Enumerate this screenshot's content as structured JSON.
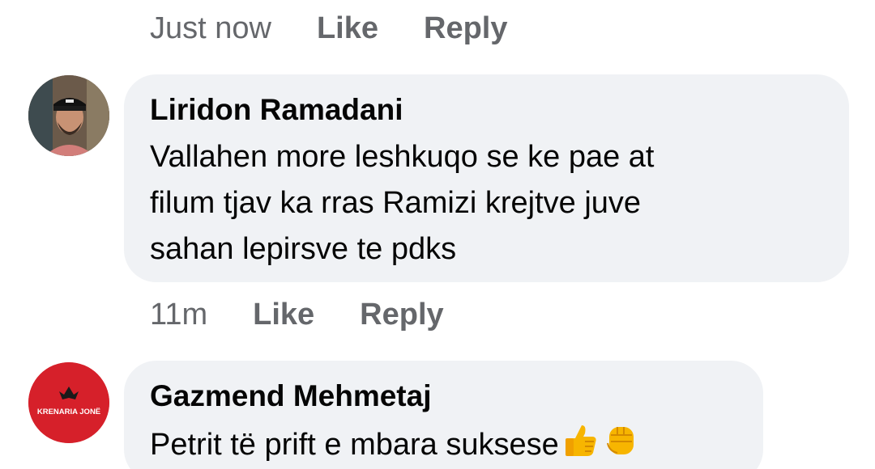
{
  "top_actions": {
    "timestamp": "Just now",
    "like_label": "Like",
    "reply_label": "Reply"
  },
  "comments": [
    {
      "author": "Liridon Ramadani",
      "text_lines": [
        "Vallahen more leshkuqo se ke pae at",
        "filum tjav ka rras Ramizi krejtve juve",
        "sahan lepirsve te pdks"
      ],
      "timestamp": "11m",
      "like_label": "Like",
      "reply_label": "Reply"
    },
    {
      "author": "Gazmend Mehmetaj",
      "avatar_text": "KRENARIA JONË",
      "text": "Petrit të prift e mbara suksese",
      "emojis": [
        "thumbs-up-icon",
        "raised-fist-icon"
      ]
    }
  ],
  "colors": {
    "bubble_bg": "#f0f2f5",
    "meta_text": "#65676b",
    "body_text": "#050505",
    "avatar2_bg": "#d6202a"
  }
}
